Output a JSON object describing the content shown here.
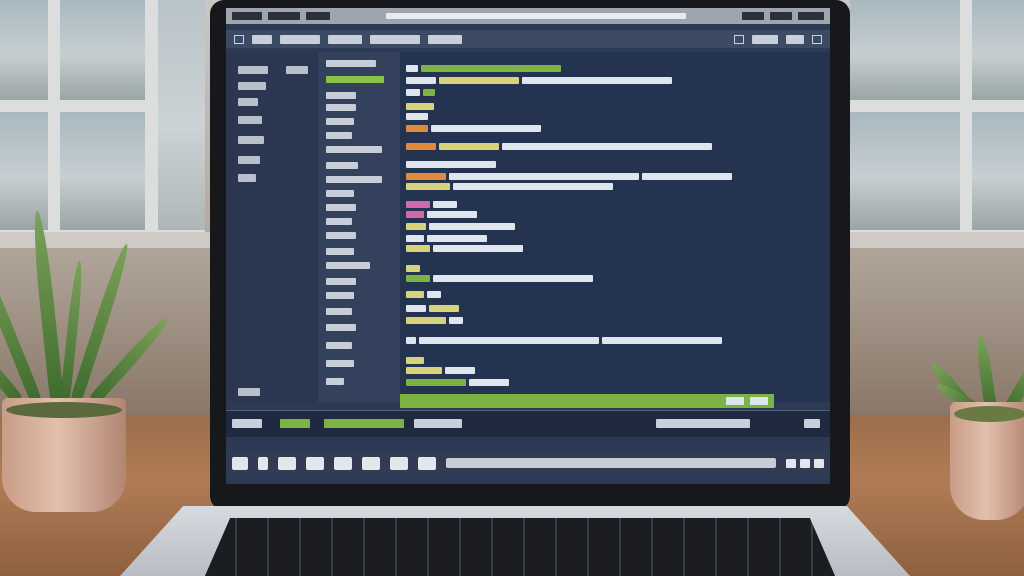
{
  "scene": {
    "description_visible_text": "",
    "colors": {
      "screen_bg": "#2c3a55",
      "accent_green": "#7cb342",
      "syntax_orange": "#e08a3a",
      "syntax_pink": "#d06aa8",
      "syntax_yellow": "#d8d27a",
      "syntax_white": "#dfe5ec"
    }
  },
  "laptop": {
    "screen": {
      "app": "code-editor",
      "titlebar": {
        "icons": [
          "minimize-icon",
          "maximize-icon",
          "close-icon"
        ]
      },
      "menubar": {
        "items": 5
      },
      "sidebar": {
        "items": 10
      },
      "explorer": {
        "items": 22,
        "active_index": 0
      },
      "editor": {
        "lines": 28
      },
      "console": {
        "buttons": 2
      },
      "taskbar": {
        "icons": 8
      }
    }
  }
}
